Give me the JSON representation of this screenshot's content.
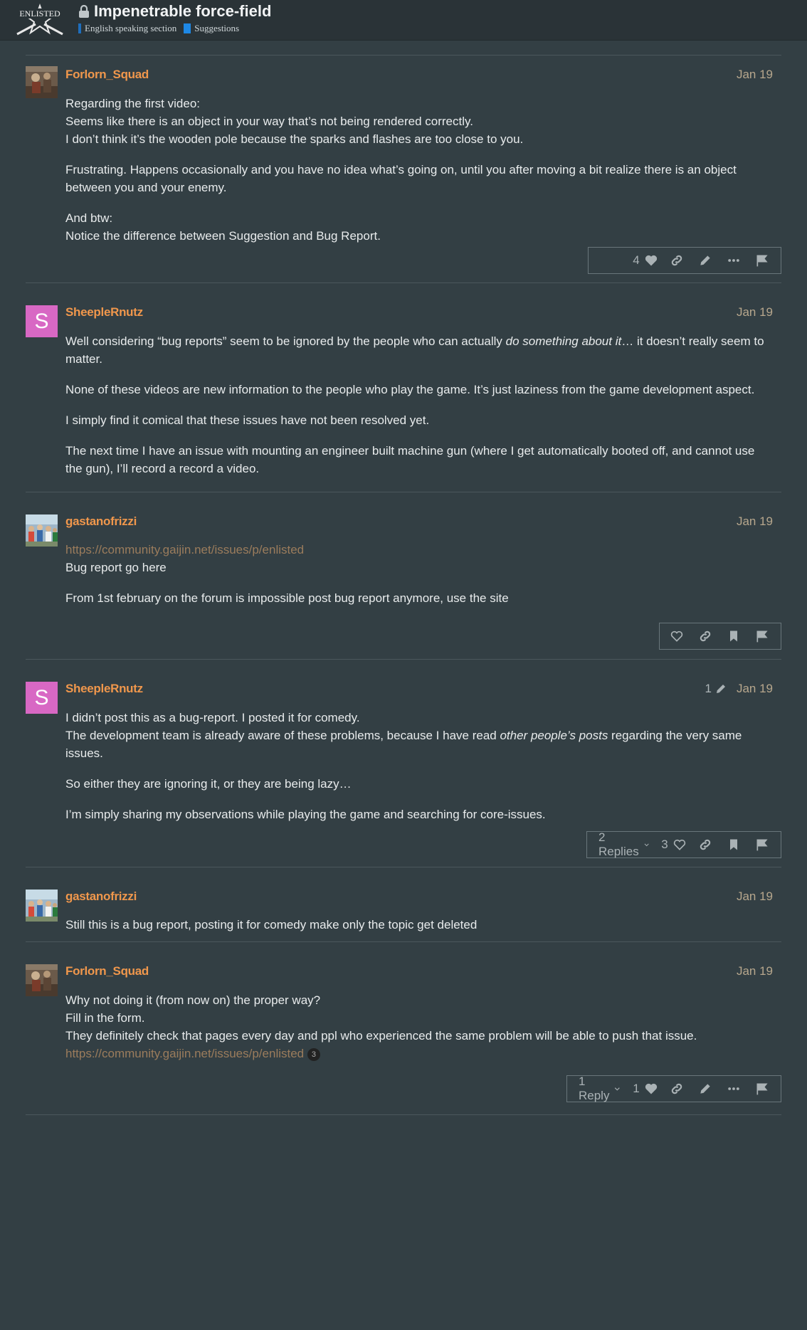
{
  "header": {
    "logo_text": "ENLISTED",
    "title": "Impenetrable force-field",
    "categories": [
      {
        "label": "English speaking section",
        "color": "#1e6ebd"
      },
      {
        "label": "Suggestions",
        "color": "#1e88e5"
      }
    ]
  },
  "colors": {
    "accent_username": "#f0974c",
    "date": "#b7a78d",
    "avatar_s": "#d868c4",
    "background": "#333f44"
  },
  "posts": [
    {
      "username": "Forlorn_Squad",
      "date": "Jan 19",
      "avatar": "soldier-avatar",
      "paragraphs": [
        [
          "Regarding the first video:",
          "Seems like there is an object in your way that’s not being rendered correctly.",
          "I don’t think it’s the wooden pole because the sparks and flashes are too close to you."
        ],
        [
          "Frustrating. Happens occasionally and you have no idea what’s going on, until you after moving a bit realize there is an object between you and your enemy."
        ],
        [
          "And btw:",
          "Notice the difference between Suggestion and Bug Report."
        ]
      ],
      "like_count": "4"
    },
    {
      "username": "SheepleRnutz",
      "date": "Jan 19",
      "avatar_letter": "S",
      "p1_before": "Well considering “bug reports” seem to be ignored by the people who can actually ",
      "p1_italic": "do something about it",
      "p1_after": "… it doesn’t really seem to matter.",
      "p2": "None of these videos are new information to the people who play the game. It’s just laziness from the game development aspect.",
      "p3": "I simply find it comical that these issues have not been resolved yet.",
      "p4": "The next time I have an issue with mounting an engineer built machine gun (where I get automatically booted off, and cannot use the gun), I’ll record a record a video."
    },
    {
      "username": "gastanofrizzi",
      "date": "Jan 19",
      "avatar": "crowd-avatar",
      "link": "https://community.gaijin.net/issues/p/enlisted",
      "line1": "Bug report go here",
      "p2": "From 1st february on the forum is impossible post bug report anymore, use the site"
    },
    {
      "username": "SheepleRnutz",
      "date": "Jan 19",
      "edit_count": "1",
      "avatar_letter": "S",
      "l1": "I didn’t post this as a bug-report. I posted it for comedy.",
      "l2_before": "The development team is already aware of these problems, because I have read ",
      "l2_italic": "other people’s posts",
      "l2_after": " regarding the very same issues.",
      "p2": "So either they are ignoring it, or they are being lazy…",
      "p3": "I’m simply sharing my observations while playing the game and searching for core-issues.",
      "replies_label": "2 Replies",
      "like_count": "3"
    },
    {
      "username": "gastanofrizzi",
      "date": "Jan 19",
      "avatar": "crowd-avatar",
      "p1": "Still this is a bug report, posting it for comedy make only the topic get deleted"
    },
    {
      "username": "Forlorn_Squad",
      "date": "Jan 19",
      "avatar": "soldier-avatar",
      "l1": "Why not doing it (from now on) the proper way?",
      "l2": "Fill in the form.",
      "l3": "They definitely check that pages every day and ppl who experienced the same problem will be able to push that issue.",
      "link": "https://community.gaijin.net/issues/p/enlisted",
      "link_clicks": "3",
      "replies_label": "1 Reply",
      "like_count": "1"
    }
  ]
}
